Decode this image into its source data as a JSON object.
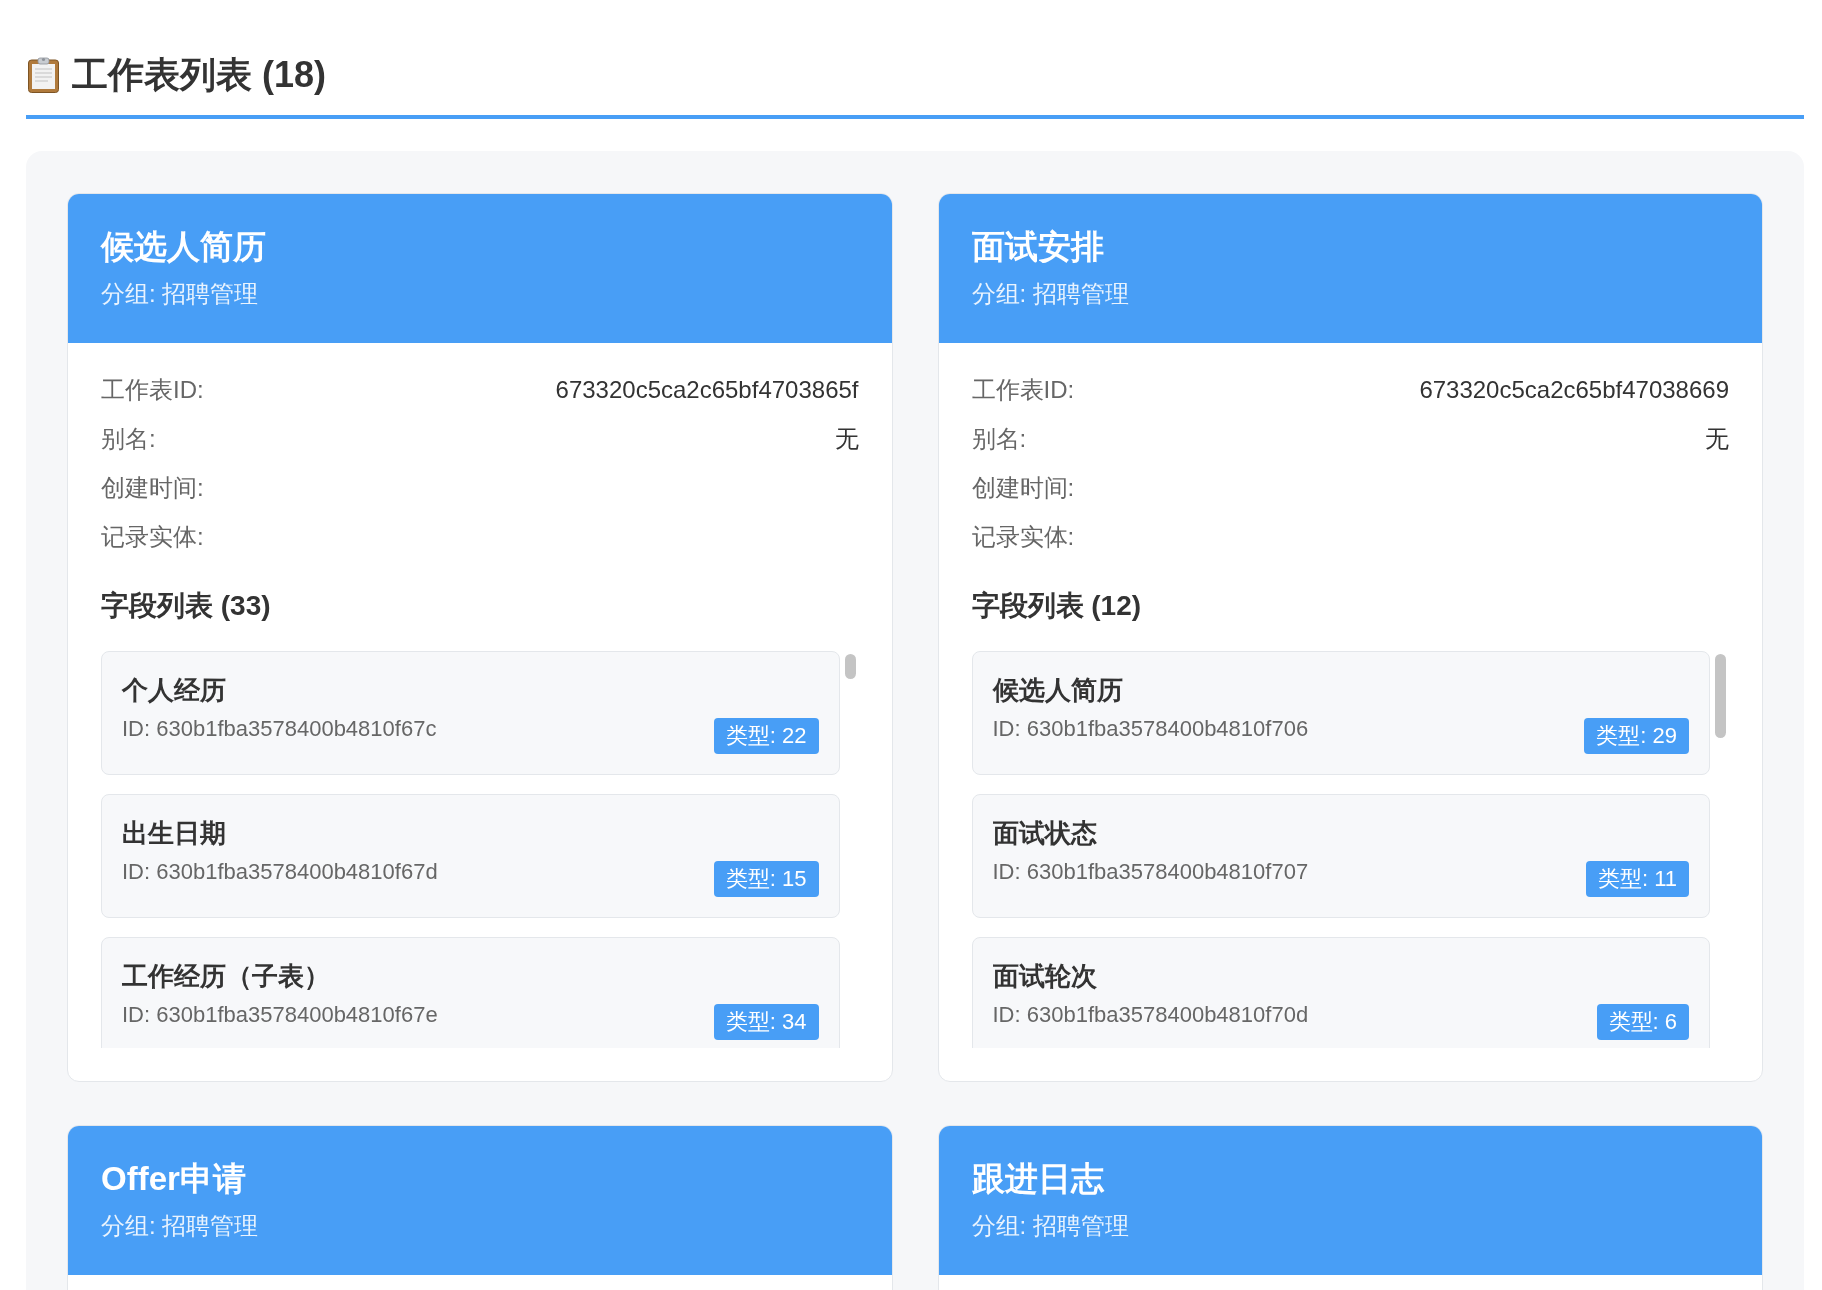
{
  "page": {
    "title": "工作表列表 (18)"
  },
  "worksheets": [
    {
      "title": "候选人简历",
      "group": "分组: 招聘管理",
      "info": [
        {
          "label": "工作表ID:",
          "value": "673320c5ca2c65bf4703865f"
        },
        {
          "label": "别名:",
          "value": "无"
        },
        {
          "label": "创建时间:"
        },
        {
          "label": "记录实体:"
        }
      ],
      "fields_title": "字段列表 (33)",
      "fields": [
        {
          "name": "个人经历",
          "id": "ID: 630b1fba3578400b4810f67c",
          "type": "类型: 22"
        },
        {
          "name": "出生日期",
          "id": "ID: 630b1fba3578400b4810f67d",
          "type": "类型: 15"
        },
        {
          "name": "工作经历（子表）",
          "id": "ID: 630b1fba3578400b4810f67e",
          "type": "类型: 34"
        }
      ]
    },
    {
      "title": "面试安排",
      "group": "分组: 招聘管理",
      "info": [
        {
          "label": "工作表ID:",
          "value": "673320c5ca2c65bf47038669"
        },
        {
          "label": "别名:",
          "value": "无"
        },
        {
          "label": "创建时间:"
        },
        {
          "label": "记录实体:"
        }
      ],
      "fields_title": "字段列表 (12)",
      "fields": [
        {
          "name": "候选人简历",
          "id": "ID: 630b1fba3578400b4810f706",
          "type": "类型: 29"
        },
        {
          "name": "面试状态",
          "id": "ID: 630b1fba3578400b4810f707",
          "type": "类型: 11"
        },
        {
          "name": "面试轮次",
          "id": "ID: 630b1fba3578400b4810f70d",
          "type": "类型: 6"
        }
      ]
    },
    {
      "title": "Offer申请",
      "group": "分组: 招聘管理"
    },
    {
      "title": "跟进日志",
      "group": "分组: 招聘管理"
    }
  ]
}
